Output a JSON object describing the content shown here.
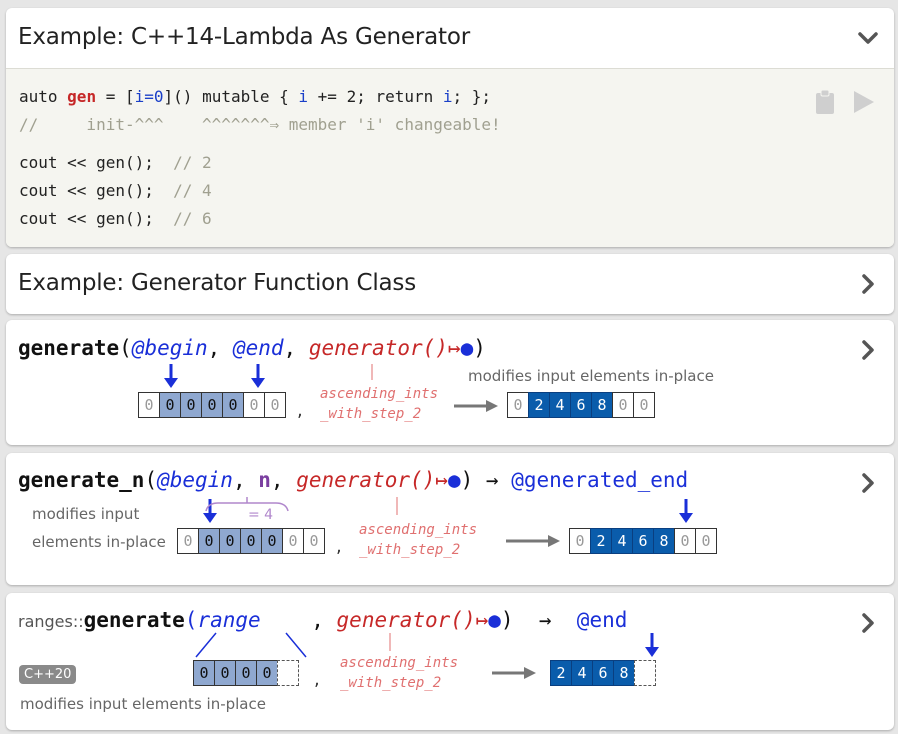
{
  "card1": {
    "title": "Example: C++14-Lambda As Generator",
    "code": {
      "line1": {
        "t1": "auto ",
        "gen": "gen",
        "t2": " = ",
        "cap1": "[",
        "cap2": "i=0",
        "cap3": "]() ",
        "t3": "mutable { ",
        "i1": "i",
        "t4": " += 2; return ",
        "i2": "i",
        "t5": "; };"
      },
      "line2": "//     init-^^^    ^^^^^^^⇒ member 'i' changeable!",
      "line3": {
        "code": "cout << gen();",
        "comment": "  // 2"
      },
      "line4": {
        "code": "cout << gen();",
        "comment": "  // 4"
      },
      "line5": {
        "code": "cout << gen();",
        "comment": "  // 6"
      }
    }
  },
  "card2": {
    "title": "Example: Generator Function Class"
  },
  "card3": {
    "sig": {
      "fn": "generate",
      "open": "(",
      "begin": "@begin",
      "c1": ", ",
      "end": "@end",
      "c2": ", ",
      "gen": "generator()",
      "arrow": "↦",
      "dot": "●",
      "close": ")"
    },
    "note": "modifies input elements in-place",
    "gen_label": "ascending_ints\n_with_step_2",
    "comma": ",",
    "input": [
      "0",
      "0",
      "0",
      "0",
      "0",
      "0",
      "0"
    ],
    "output": [
      "0",
      "2",
      "4",
      "6",
      "8",
      "0",
      "0"
    ]
  },
  "card4": {
    "sig": {
      "fn": "generate_n",
      "open": "(",
      "begin": "@begin",
      "c1": ", ",
      "n": "n",
      "c2": ", ",
      "gen": "generator()",
      "arrow": "↦",
      "dot": "●",
      "close": ")",
      "ret_arrow": " → ",
      "ret": "@generated_end"
    },
    "note1": "modifies input",
    "note2": "elements in-place",
    "n_value": "= 4",
    "gen_label": "ascending_ints\n_with_step_2",
    "comma": ",",
    "input": [
      "0",
      "0",
      "0",
      "0",
      "0",
      "0",
      "0"
    ],
    "output": [
      "0",
      "2",
      "4",
      "6",
      "8",
      "0",
      "0"
    ]
  },
  "card5": {
    "sig": {
      "ns": "ranges::",
      "fn": "generate",
      "open": "(",
      "range": "range",
      "c2": "    , ",
      "gen": "generator()",
      "arrow": "↦",
      "dot": "●",
      "close": ")",
      "ret_arrow": "  →  ",
      "ret": "@end"
    },
    "badge": "C++20",
    "note": "modifies input elements in-place",
    "gen_label": "ascending_ints\n_with_step_2",
    "comma": ",",
    "input": [
      "0",
      "0",
      "0",
      "0"
    ],
    "output": [
      "2",
      "4",
      "6",
      "8"
    ]
  },
  "colors": {
    "accent_blue": "#1a2fd8",
    "accent_red": "#c62828",
    "output_fill": "#0a5cab",
    "selected_fill": "#8fa8d0"
  }
}
